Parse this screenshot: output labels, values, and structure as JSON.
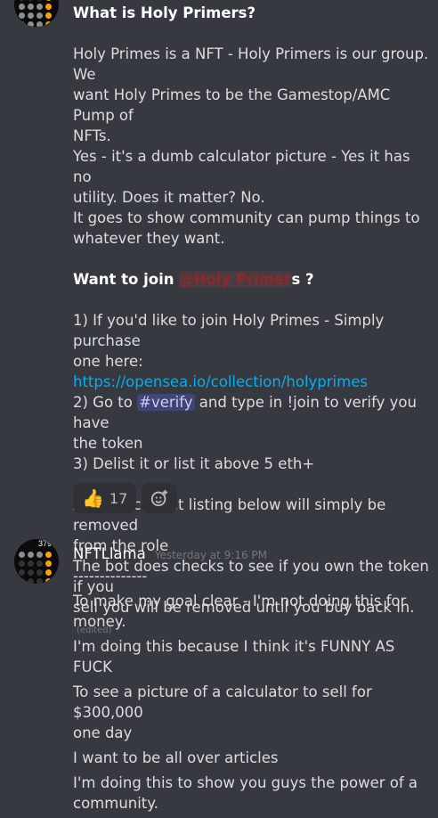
{
  "message1": {
    "heading": "What is Holy Primers?",
    "paragraph1": [
      "Holy Primes is a NFT - Holy Primers is our group. We",
      "want Holy Primes to be the Gamestop/AMC Pump of",
      "NFTs.",
      "Yes - it's a dumb calculator picture - Yes it has no",
      "utility. Does it matter? No.",
      "It goes to show community can pump things to",
      "whatever they want."
    ],
    "want_to_join_prefix": "Want to join ",
    "role_mention": "@Holy Primer",
    "want_to_join_suffix": "s ?",
    "step1_text": "1) If you'd like to join Holy Primes - Simply purchase",
    "step1_text2": "one here:",
    "link": "https://opensea.io/collection/holyprimes",
    "step2_prefix": "2) Go to ",
    "channel_mention": "#verify",
    "step2_suffix": " and type in !join to verify you have",
    "step2_line2": "the token",
    "step3": "3) Delist it or list it above 5 eth+",
    "closing": [
      "Anyone caught listing below will simply be removed",
      "from the role",
      "The bot does checks to see if you own the token if you"
    ],
    "closing_last": "sell you will be removed until you buy back in.",
    "edited_label": "(edited)",
    "reactions": [
      {
        "emoji": "👍",
        "count": "17",
        "icon": "thumbs-up-icon"
      }
    ],
    "add_reaction_icon": "add-reaction-icon"
  },
  "message2": {
    "username": "NFTLlama",
    "timestamp": "Yesterday at 9:16 PM",
    "avatar_readout": "379",
    "lines": [
      "--------------",
      "To make my goal clear - I'm not doing this for money.",
      "I'm doing this because I think it's FUNNY AS FUCK",
      "To see a picture of a calculator to sell for $300,000",
      "one day",
      "I want to be all over articles",
      "I'm doing this to show you guys the power of a",
      "community."
    ]
  },
  "colors": {
    "background": "#36393f",
    "text": "#dcddde",
    "link": "#00b0f4",
    "calculator_orange": "#ff9f0a"
  }
}
